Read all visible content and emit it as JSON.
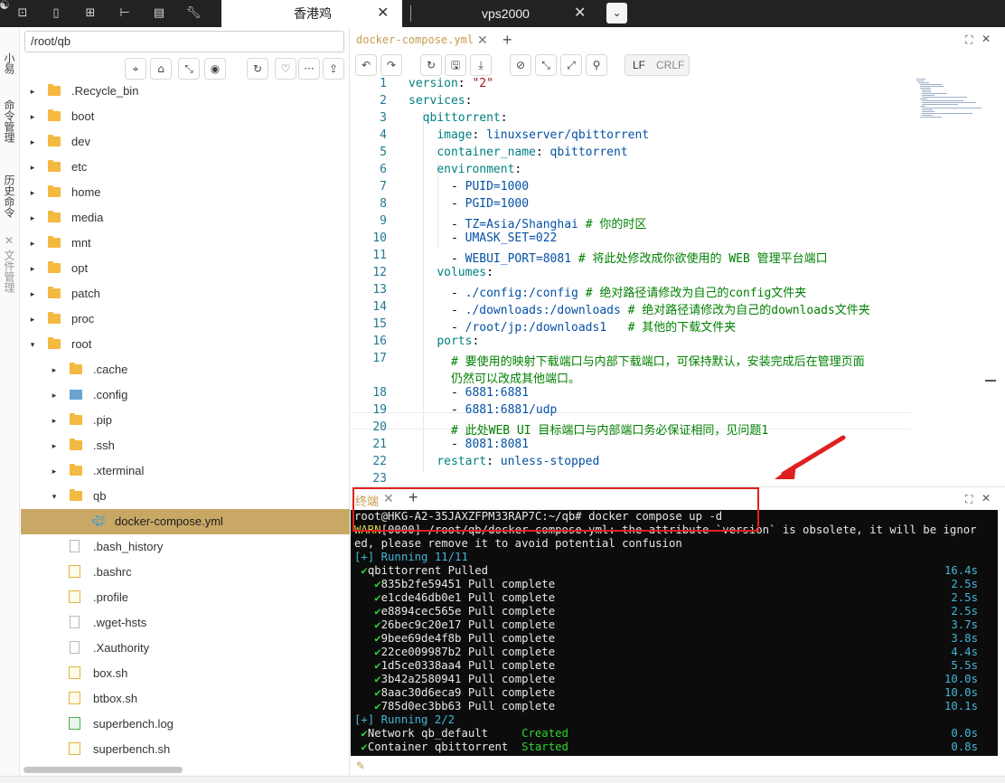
{
  "topbar": {
    "icons": [
      "terminal-icon",
      "file-icon",
      "grid-icon",
      "tree-icon",
      "table-icon",
      "wrench-icon"
    ],
    "tabs": [
      {
        "label": "香港鸡",
        "close": "✕"
      },
      {
        "label": "vps2000",
        "close": "✕"
      }
    ],
    "dropdown": "⌄"
  },
  "sidebar": {
    "items": [
      "小易",
      "命令管理",
      "历史命令",
      "✕",
      "文件管理"
    ]
  },
  "filetree": {
    "path": "/root/qb",
    "toolbar": [
      "⌖",
      "⌂",
      "⤡",
      "◉",
      "↻",
      "♡",
      "···",
      "⇪"
    ],
    "rows": [
      {
        "label": ".Recycle_bin",
        "type": "folder",
        "depth": 0,
        "arrow": "▸"
      },
      {
        "label": "boot",
        "type": "folder",
        "depth": 0,
        "arrow": "▸"
      },
      {
        "label": "dev",
        "type": "folder",
        "depth": 0,
        "arrow": "▸"
      },
      {
        "label": "etc",
        "type": "folder",
        "depth": 0,
        "arrow": "▸"
      },
      {
        "label": "home",
        "type": "folder",
        "depth": 0,
        "arrow": "▸"
      },
      {
        "label": "media",
        "type": "folder",
        "depth": 0,
        "arrow": "▸"
      },
      {
        "label": "mnt",
        "type": "folder",
        "depth": 0,
        "arrow": "▸"
      },
      {
        "label": "opt",
        "type": "folder",
        "depth": 0,
        "arrow": "▸"
      },
      {
        "label": "patch",
        "type": "folder",
        "depth": 0,
        "arrow": "▸"
      },
      {
        "label": "proc",
        "type": "folder",
        "depth": 0,
        "arrow": "▸"
      },
      {
        "label": "root",
        "type": "folder",
        "depth": 0,
        "arrow": "▾"
      },
      {
        "label": ".cache",
        "type": "folder",
        "depth": 1,
        "arrow": "▸"
      },
      {
        "label": ".config",
        "type": "gearfolder",
        "depth": 1,
        "arrow": "▸"
      },
      {
        "label": ".pip",
        "type": "folder",
        "depth": 1,
        "arrow": "▸"
      },
      {
        "label": ".ssh",
        "type": "folder",
        "depth": 1,
        "arrow": "▸"
      },
      {
        "label": ".xterminal",
        "type": "folder",
        "depth": 1,
        "arrow": "▸"
      },
      {
        "label": "qb",
        "type": "folder",
        "depth": 1,
        "arrow": "▾"
      },
      {
        "label": "docker-compose.yml",
        "type": "docker",
        "depth": 2,
        "arrow": ""
      },
      {
        "label": ".bash_history",
        "type": "file",
        "depth": 1,
        "arrow": ""
      },
      {
        "label": ".bashrc",
        "type": "sh",
        "depth": 1,
        "arrow": ""
      },
      {
        "label": ".profile",
        "type": "sh",
        "depth": 1,
        "arrow": ""
      },
      {
        "label": ".wget-hsts",
        "type": "file",
        "depth": 1,
        "arrow": ""
      },
      {
        "label": ".Xauthority",
        "type": "file",
        "depth": 1,
        "arrow": ""
      },
      {
        "label": "box.sh",
        "type": "sh",
        "depth": 1,
        "arrow": ""
      },
      {
        "label": "btbox.sh",
        "type": "sh",
        "depth": 1,
        "arrow": ""
      },
      {
        "label": "superbench.log",
        "type": "log",
        "depth": 1,
        "arrow": ""
      },
      {
        "label": "superbench.sh",
        "type": "sh",
        "depth": 1,
        "arrow": ""
      }
    ]
  },
  "editor": {
    "tab": "docker-compose.yml",
    "close": "✕",
    "plus": "+",
    "toolbar": [
      "↶",
      "↷",
      "↻",
      "🖫",
      "⤓",
      "⊘",
      "⤡",
      "⤢",
      "⚲"
    ],
    "lf": "LF",
    "crlf": "CRLF",
    "lines": [
      {
        "n": "1",
        "html": "<span class='k'>version</span>: <span class='s'>\"2\"</span>"
      },
      {
        "n": "2",
        "html": "<span class='k'>services</span>:"
      },
      {
        "n": "3",
        "html": "  <span class='k'>qbittorrent</span>:"
      },
      {
        "n": "4",
        "html": "    <span class='k'>image</span>: <span class='v'>linuxserver/qbittorrent</span>"
      },
      {
        "n": "5",
        "html": "    <span class='k'>container_name</span>: <span class='v'>qbittorrent</span>"
      },
      {
        "n": "6",
        "html": "    <span class='k'>environment</span>:"
      },
      {
        "n": "7",
        "html": "      - <span class='v'>PUID=1000</span>"
      },
      {
        "n": "8",
        "html": "      - <span class='v'>PGID=1000</span>"
      },
      {
        "n": "9",
        "html": "      - <span class='v'>TZ=Asia/Shanghai</span> <span class='cm'># 你的时区</span>"
      },
      {
        "n": "10",
        "html": "      - <span class='v'>UMASK_SET=022</span>"
      },
      {
        "n": "11",
        "html": "      - <span class='v'>WEBUI_PORT=8081</span> <span class='cm'># 将此处修改成你欲使用的 WEB 管理平台端口</span>"
      },
      {
        "n": "12",
        "html": "    <span class='k'>volumes</span>:"
      },
      {
        "n": "13",
        "html": "      - <span class='v'>./config:/config</span> <span class='cm'># 绝对路径请修改为自己的config文件夹</span>"
      },
      {
        "n": "14",
        "html": "      - <span class='v'>./downloads:/downloads</span> <span class='cm'># 绝对路径请修改为自己的downloads文件夹</span>"
      },
      {
        "n": "15",
        "html": "      - <span class='v'>/root/jp:/downloads1</span>   <span class='cm'># 其他的下载文件夹</span>"
      },
      {
        "n": "16",
        "html": "    <span class='k'>ports</span>:"
      },
      {
        "n": "17",
        "html": "      <span class='cm'># 要使用的映射下载端口与内部下载端口，可保持默认，安装完成后在管理页面</span>"
      },
      {
        "n": "",
        "html": "      <span class='cm'>仍然可以改成其他端口。</span>"
      },
      {
        "n": "18",
        "html": "      - <span class='v'>6881:6881</span>"
      },
      {
        "n": "19",
        "html": "      - <span class='v'>6881:6881/udp</span>"
      },
      {
        "n": "20",
        "html": "      <span class='cm'># 此处WEB UI 目标端口与内部端口务必保证相同，见问题1</span>"
      },
      {
        "n": "21",
        "html": "      - <span class='v'>8081:8081</span>"
      },
      {
        "n": "22",
        "html": "    <span class='k'>restart</span>: <span class='v'>unless-stopped</span>"
      },
      {
        "n": "23",
        "html": ""
      }
    ]
  },
  "terminal": {
    "tab": "终端",
    "close": "✕",
    "plus": "+",
    "lines": [
      {
        "html": "root@HKG-A2-35JAXZFPM33RAP7C:~/qb# docker compose up -d",
        "right": ""
      },
      {
        "html": "<span class='yel'>WARN</span>[0000] /root/qb/docker-compose.yml: the attribute `version` is obsolete, it will be ignor",
        "right": ""
      },
      {
        "html": "ed, please remove it to avoid potential confusion",
        "right": ""
      },
      {
        "html": "<span class='cyan'>[+] Running 11/11</span>",
        "right": ""
      },
      {
        "html": " <span class='grn'>✔</span>qbittorrent Pulled",
        "right": "16.4s"
      },
      {
        "html": "   <span class='grn'>✔</span>835b2fe59451 Pull complete",
        "right": "2.5s"
      },
      {
        "html": "   <span class='grn'>✔</span>e1cde46db0e1 Pull complete",
        "right": "2.5s"
      },
      {
        "html": "   <span class='grn'>✔</span>e8894cec565e Pull complete",
        "right": "2.5s"
      },
      {
        "html": "   <span class='grn'>✔</span>26bec9c20e17 Pull complete",
        "right": "3.7s"
      },
      {
        "html": "   <span class='grn'>✔</span>9bee69de4f8b Pull complete",
        "right": "3.8s"
      },
      {
        "html": "   <span class='grn'>✔</span>22ce009987b2 Pull complete",
        "right": "4.4s"
      },
      {
        "html": "   <span class='grn'>✔</span>1d5ce0338aa4 Pull complete",
        "right": "5.5s"
      },
      {
        "html": "   <span class='grn'>✔</span>3b42a2580941 Pull complete",
        "right": "10.0s"
      },
      {
        "html": "   <span class='grn'>✔</span>8aac30d6eca9 Pull complete",
        "right": "10.0s"
      },
      {
        "html": "   <span class='grn'>✔</span>785d0ec3bb63 Pull complete",
        "right": "10.1s"
      },
      {
        "html": "<span class='cyan'>[+] Running 2/2</span>",
        "right": ""
      },
      {
        "html": " <span class='grn'>✔</span>Network qb_default     <span class='grn'>Created</span>",
        "right": "0.0s"
      },
      {
        "html": " <span class='grn'>✔</span>Container qbittorrent  <span class='grn'>Started</span>",
        "right": "0.8s"
      }
    ]
  },
  "statusbar": {
    "icon": "✎"
  },
  "colors": {
    "accent": "#c69c4e",
    "selected_row": "#c9a866",
    "highlight_box": "#e02020",
    "arrow": "#e02020"
  }
}
